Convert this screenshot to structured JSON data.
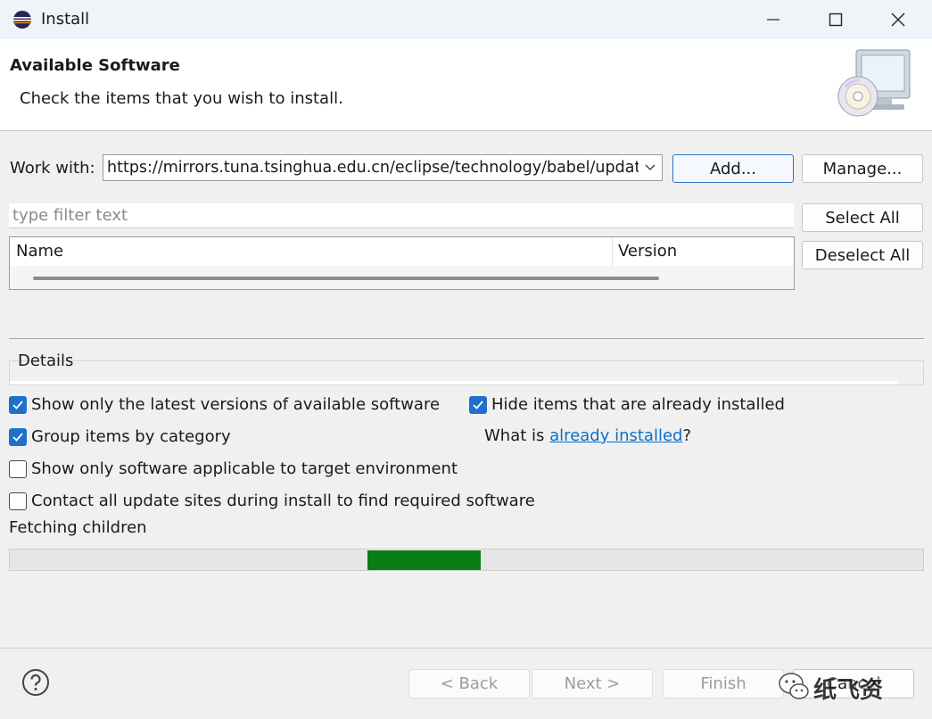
{
  "window": {
    "title": "Install",
    "minimize_icon": "minimize-icon",
    "maximize_icon": "maximize-icon",
    "close_icon": "close-icon"
  },
  "header": {
    "title": "Available Software",
    "description": "Check the items that you wish to install."
  },
  "work_with": {
    "label": "Work with:",
    "value": "https://mirrors.tuna.tsinghua.edu.cn/eclipse/technology/babel/updat",
    "add_button": "Add...",
    "manage_button": "Manage..."
  },
  "filter": {
    "placeholder": "type filter text"
  },
  "selection": {
    "select_all": "Select All",
    "deselect_all": "Deselect All"
  },
  "table": {
    "columns": [
      "Name",
      "Version"
    ]
  },
  "details": {
    "label": "Details"
  },
  "options": [
    {
      "label": "Show only the latest versions of available software",
      "checked": true
    },
    {
      "label": "Group items by category",
      "checked": true
    },
    {
      "label": "Show only software applicable to target environment",
      "checked": false
    },
    {
      "label": "Contact all update sites during install to find required software",
      "checked": false
    },
    {
      "label": "Hide items that are already installed",
      "checked": true
    }
  ],
  "installed_info": {
    "prefix": "What is ",
    "link": "already installed",
    "suffix": "?"
  },
  "status": {
    "text": "Fetching children"
  },
  "progress": {
    "fill_start": 0.392,
    "fill_end": 0.516,
    "color": "#0b7d17"
  },
  "footer": {
    "back_button": "< Back",
    "next_button": "Next >",
    "finish_button": "Finish",
    "cancel_button": "Cancel"
  },
  "watermark": {
    "text": "纸飞资"
  },
  "colors": {
    "accent": "#1f6fcb",
    "link": "#0b6fc9"
  }
}
